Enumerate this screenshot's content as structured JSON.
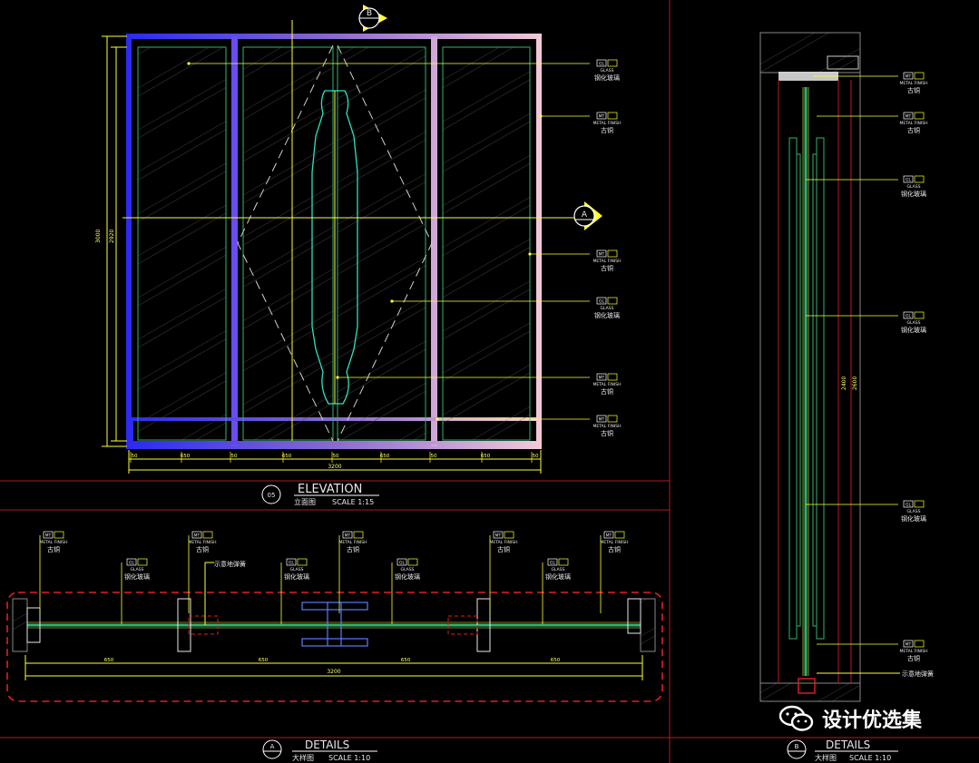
{
  "elevation": {
    "title": "ELEVATION",
    "subtitle_cn": "立面图",
    "scale": "SCALE  1:15",
    "symbol": "05",
    "section_b": "B",
    "section_a": "A",
    "dims_bottom": [
      "50",
      "650",
      "50",
      "650",
      "50",
      "650",
      "50",
      "650",
      "50"
    ],
    "dim_total": "3200",
    "dim_left_outer": "3000",
    "dim_left_inner": "2920",
    "callouts": [
      {
        "code": "GL",
        "en": "GLASS",
        "cn": "钢化玻璃"
      },
      {
        "code": "MT",
        "en": "METAL FINISH",
        "cn": "古铜"
      },
      {
        "code": "MT",
        "en": "METAL FINISH",
        "cn": "古铜"
      },
      {
        "code": "GL",
        "en": "GLASS",
        "cn": "钢化玻璃"
      },
      {
        "code": "MT",
        "en": "METAL FINISH",
        "cn": "古铜"
      },
      {
        "code": "MT",
        "en": "METAL FINISH",
        "cn": "古铜"
      }
    ]
  },
  "detail_a": {
    "title": "DETAILS",
    "subtitle_cn": "大样图",
    "scale": "SCALE  1:10",
    "symbol": "A",
    "dims": [
      "650",
      "650",
      "650",
      "650"
    ],
    "dim_total": "3200",
    "note_cn": "示意地弹簧",
    "callouts_top": [
      {
        "code": "MT",
        "en": "METAL FINISH",
        "cn": "古铜"
      },
      {
        "code": "MT",
        "en": "METAL FINISH",
        "cn": "古铜"
      },
      {
        "code": "MT",
        "en": "METAL FINISH",
        "cn": "古铜"
      },
      {
        "code": "MT",
        "en": "METAL FINISH",
        "cn": "古铜"
      },
      {
        "code": "MT",
        "en": "METAL FINISH",
        "cn": "古铜"
      }
    ],
    "callouts_glass": [
      {
        "code": "GL",
        "en": "GLASS",
        "cn": "钢化玻璃"
      },
      {
        "code": "GL",
        "en": "GLASS",
        "cn": "钢化玻璃"
      },
      {
        "code": "GL",
        "en": "GLASS",
        "cn": "钢化玻璃"
      },
      {
        "code": "GL",
        "en": "GLASS",
        "cn": "钢化玻璃"
      }
    ]
  },
  "detail_b": {
    "title": "DETAILS",
    "subtitle_cn": "大样图",
    "scale": "SCALE  1:10",
    "symbol": "B",
    "dim_a": "2400",
    "dim_b": "2600",
    "note_cn": "示意地弹簧",
    "callouts": [
      {
        "code": "MT",
        "en": "METAL FINISH",
        "cn": "古铜"
      },
      {
        "code": "MT",
        "en": "METAL FINISH",
        "cn": "古铜"
      },
      {
        "code": "GL",
        "en": "GLASS",
        "cn": "钢化玻璃"
      },
      {
        "code": "GL",
        "en": "GLASS",
        "cn": "钢化玻璃"
      },
      {
        "code": "GL",
        "en": "GLASS",
        "cn": "钢化玻璃"
      },
      {
        "code": "MT",
        "en": "METAL FINISH",
        "cn": "古铜"
      }
    ]
  },
  "watermark": "设计优选集",
  "colors": {
    "yellow": "#ffff33",
    "red": "#c0161e",
    "green": "#2fb36f",
    "cyan": "#33e0e0",
    "blue": "#2b2bf2"
  }
}
